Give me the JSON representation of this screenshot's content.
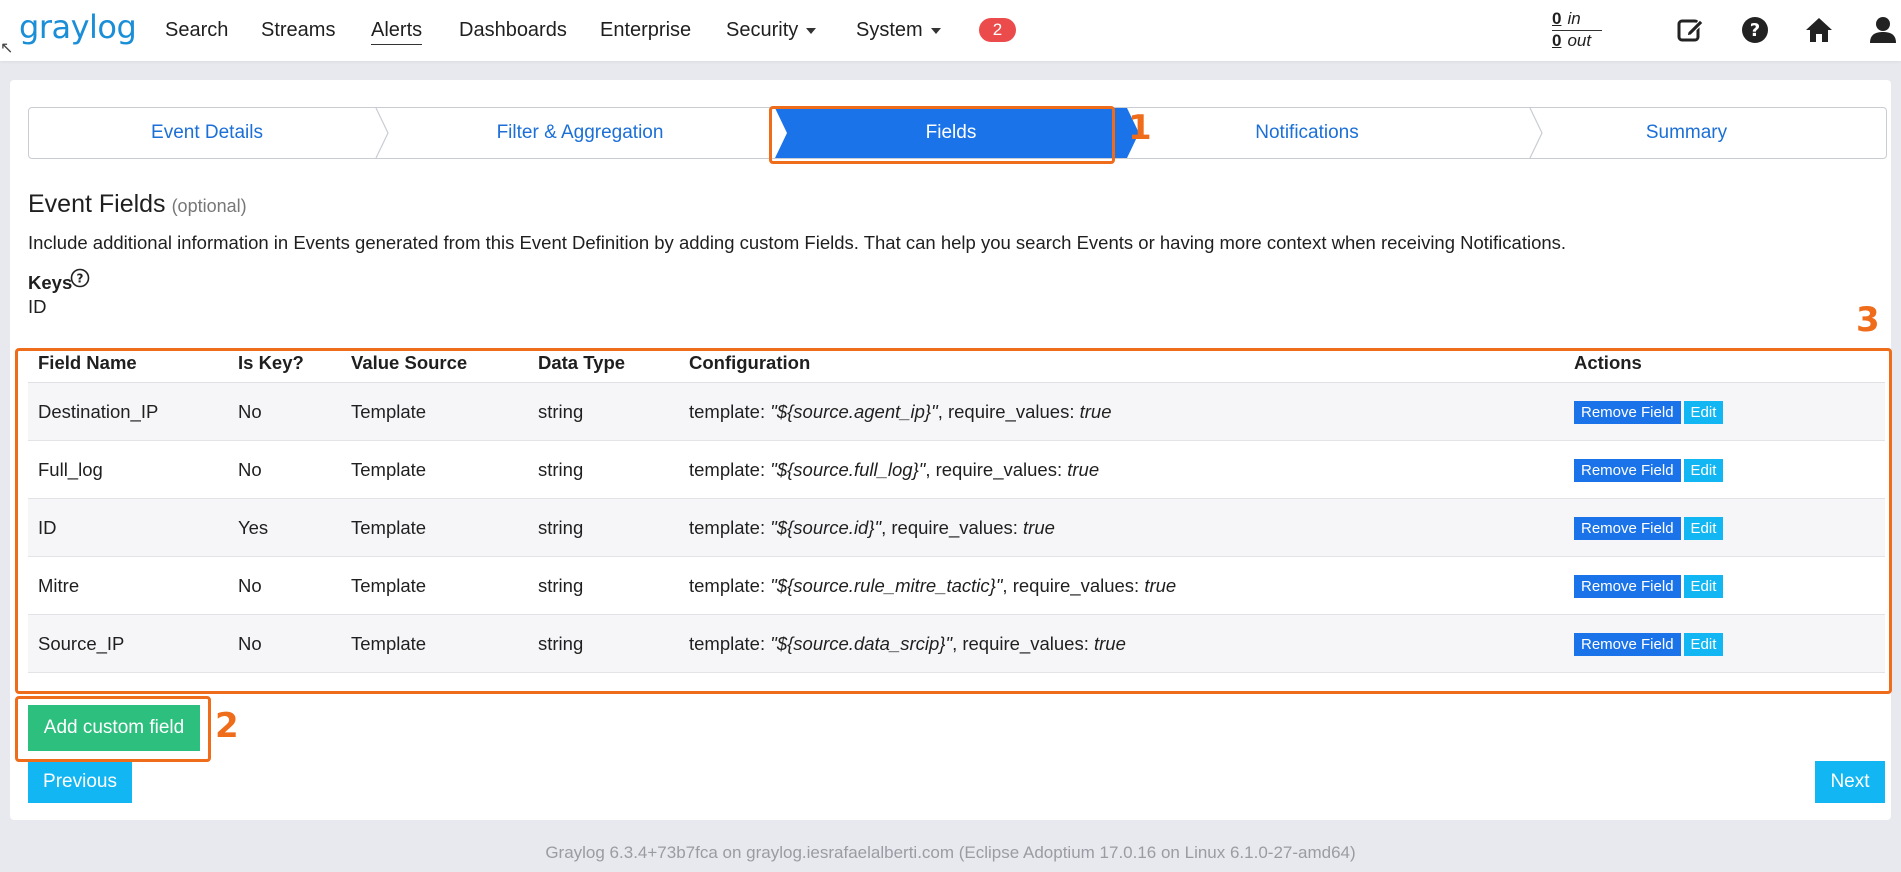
{
  "nav": {
    "logo": "graylog",
    "items": [
      {
        "label": "Search"
      },
      {
        "label": "Streams"
      },
      {
        "label": "Alerts"
      },
      {
        "label": "Dashboards"
      },
      {
        "label": "Enterprise"
      },
      {
        "label": "Security"
      },
      {
        "label": "System"
      }
    ],
    "notification_count": "2",
    "throughput": {
      "in_value": "0",
      "in_label": "in",
      "out_value": "0",
      "out_label": "out"
    },
    "icons": [
      "edit-icon",
      "help-icon",
      "home-icon",
      "user-icon"
    ]
  },
  "wizard": {
    "steps": [
      {
        "label": "Event Details"
      },
      {
        "label": "Filter & Aggregation"
      },
      {
        "label": "Fields"
      },
      {
        "label": "Notifications"
      },
      {
        "label": "Summary"
      }
    ],
    "active_step": "Fields"
  },
  "section": {
    "title": "Event Fields",
    "optional": "(optional)",
    "description": "Include additional information in Events generated from this Event Definition by adding custom Fields. That can help you search Events or having more context when receiving Notifications.",
    "keys_label": "Keys",
    "keys_value": "ID"
  },
  "table": {
    "headers": [
      "Field Name",
      "Is Key?",
      "Value Source",
      "Data Type",
      "Configuration",
      "Actions"
    ],
    "rows": [
      {
        "name": "Destination_IP",
        "is_key": "No",
        "source": "Template",
        "type": "string",
        "template": "\"${source.agent_ip}\"",
        "require": "true"
      },
      {
        "name": "Full_log",
        "is_key": "No",
        "source": "Template",
        "type": "string",
        "template": "\"${source.full_log}\"",
        "require": "true"
      },
      {
        "name": "ID",
        "is_key": "Yes",
        "source": "Template",
        "type": "string",
        "template": "\"${source.id}\"",
        "require": "true"
      },
      {
        "name": "Mitre",
        "is_key": "No",
        "source": "Template",
        "type": "string",
        "template": "\"${source.rule_mitre_tactic}\"",
        "require": "true"
      },
      {
        "name": "Source_IP",
        "is_key": "No",
        "source": "Template",
        "type": "string",
        "template": "\"${source.data_srcip}\"",
        "require": "true"
      }
    ],
    "template_prefix": "template:",
    "require_prefix": ", require_values:",
    "remove_label": "Remove Field",
    "edit_label": "Edit"
  },
  "buttons": {
    "add": "Add custom field",
    "previous": "Previous",
    "next": "Next"
  },
  "annotations": {
    "one": "1",
    "two": "2",
    "three": "3"
  },
  "footer": "Graylog 6.3.4+73b7fca on graylog.iesrafaelalberti.com (Eclipse Adoptium 17.0.16 on Linux 6.1.0-27-amd64)",
  "colors": {
    "primary": "#1a73e8",
    "info": "#12b6f2",
    "success": "#2dbf7e",
    "danger": "#eb4b4b",
    "annotation": "#ef6c1a"
  }
}
